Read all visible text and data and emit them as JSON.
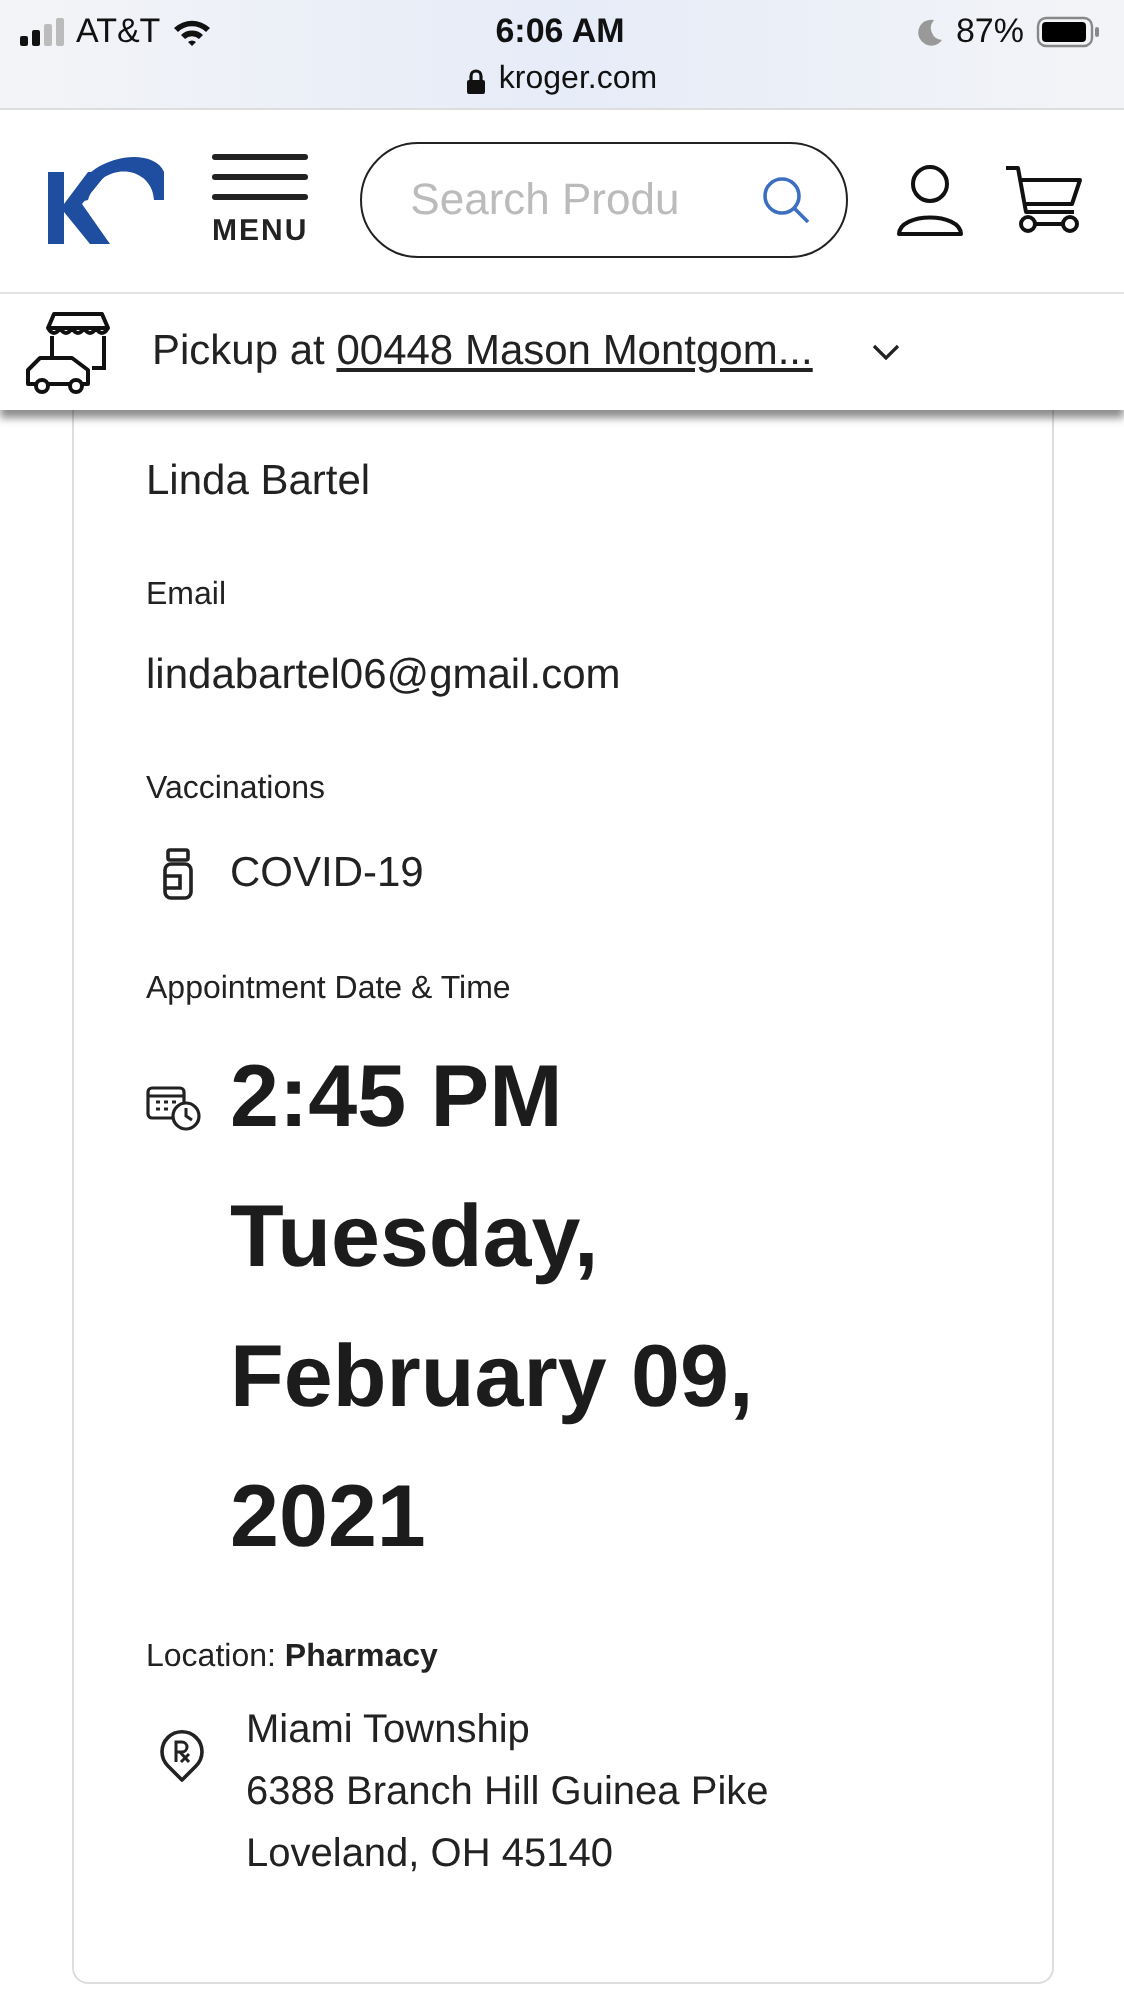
{
  "status_bar": {
    "carrier": "AT&T",
    "time": "6:06 AM",
    "battery": "87%",
    "url": "kroger.com"
  },
  "header": {
    "menu_label": "MENU",
    "search": {
      "placeholder": "Search Produ"
    }
  },
  "pickup": {
    "prefix": "Pickup at",
    "store": "00448 Mason Montgom..."
  },
  "appointment": {
    "name": "Linda Bartel",
    "email_label": "Email",
    "email": "lindabartel06@gmail.com",
    "vaccinations_label": "Vaccinations",
    "vaccine": "COVID-19",
    "datetime_label": "Appointment Date & Time",
    "time": "2:45 PM",
    "date": "Tuesday, February 09, 2021",
    "location_label": "Location: **Pharmacy**",
    "location_name": "Miami Township",
    "address_line_1": "6388 Branch Hill Guinea Pike",
    "address_line_2": "Loveland, OH 45140"
  }
}
